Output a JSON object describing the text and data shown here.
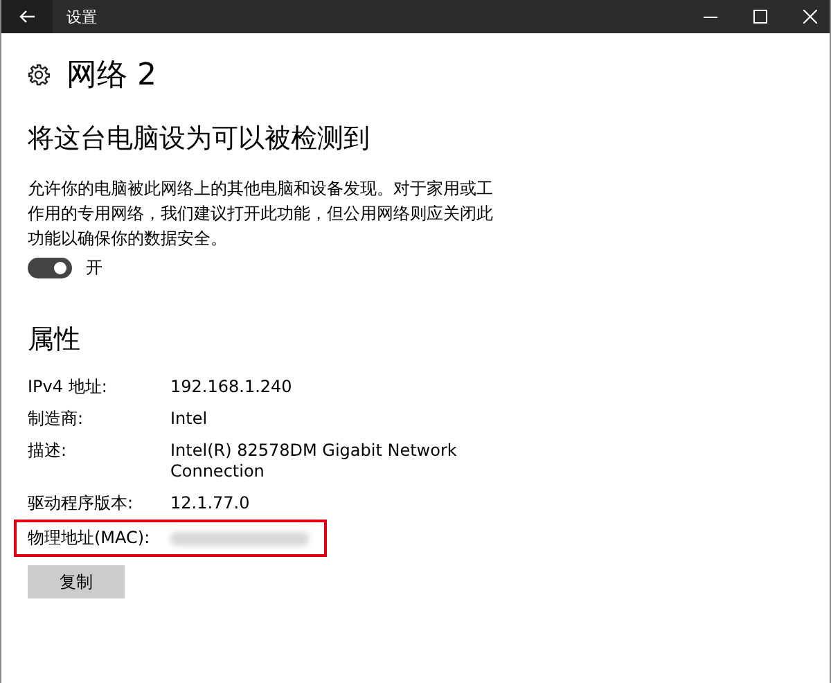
{
  "window": {
    "title": "设置"
  },
  "page_title": "网络 2",
  "discovery": {
    "heading": "将这台电脑设为可以被检测到",
    "description": "允许你的电脑被此网络上的其他电脑和设备发现。对于家用或工作用的专用网络，我们建议打开此功能，但公用网络则应关闭此功能以确保你的数据安全。",
    "toggle": {
      "on": true,
      "label": "开"
    }
  },
  "properties": {
    "heading": "属性",
    "rows": [
      {
        "label": "IPv4 地址:",
        "value": "192.168.1.240",
        "highlighted": false
      },
      {
        "label": "制造商:",
        "value": "Intel",
        "highlighted": false
      },
      {
        "label": "描述:",
        "value": "Intel(R) 82578DM Gigabit Network Connection",
        "highlighted": false
      },
      {
        "label": "驱动程序版本:",
        "value": "12.1.77.0",
        "highlighted": false
      },
      {
        "label": "物理地址(MAC):",
        "kind": "redacted",
        "highlighted": true
      }
    ],
    "copy_button": "复制"
  }
}
